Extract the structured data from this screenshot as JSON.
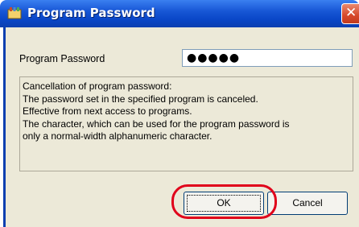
{
  "window": {
    "title": "Program Password",
    "close_glyph": "✕"
  },
  "form": {
    "password_label": "Program Password",
    "password_value": "●●●●●"
  },
  "description": {
    "lines": [
      "Cancellation of program password:",
      "The password set in the specified program is canceled.",
      "Effective from next access to programs.",
      "The character, which can be used for the program password is",
      "only a normal-width alphanumeric character."
    ]
  },
  "buttons": {
    "ok_label": "OK",
    "cancel_label": "Cancel"
  },
  "colors": {
    "highlight": "#e0001a",
    "titlebar": "#0a47c8"
  }
}
